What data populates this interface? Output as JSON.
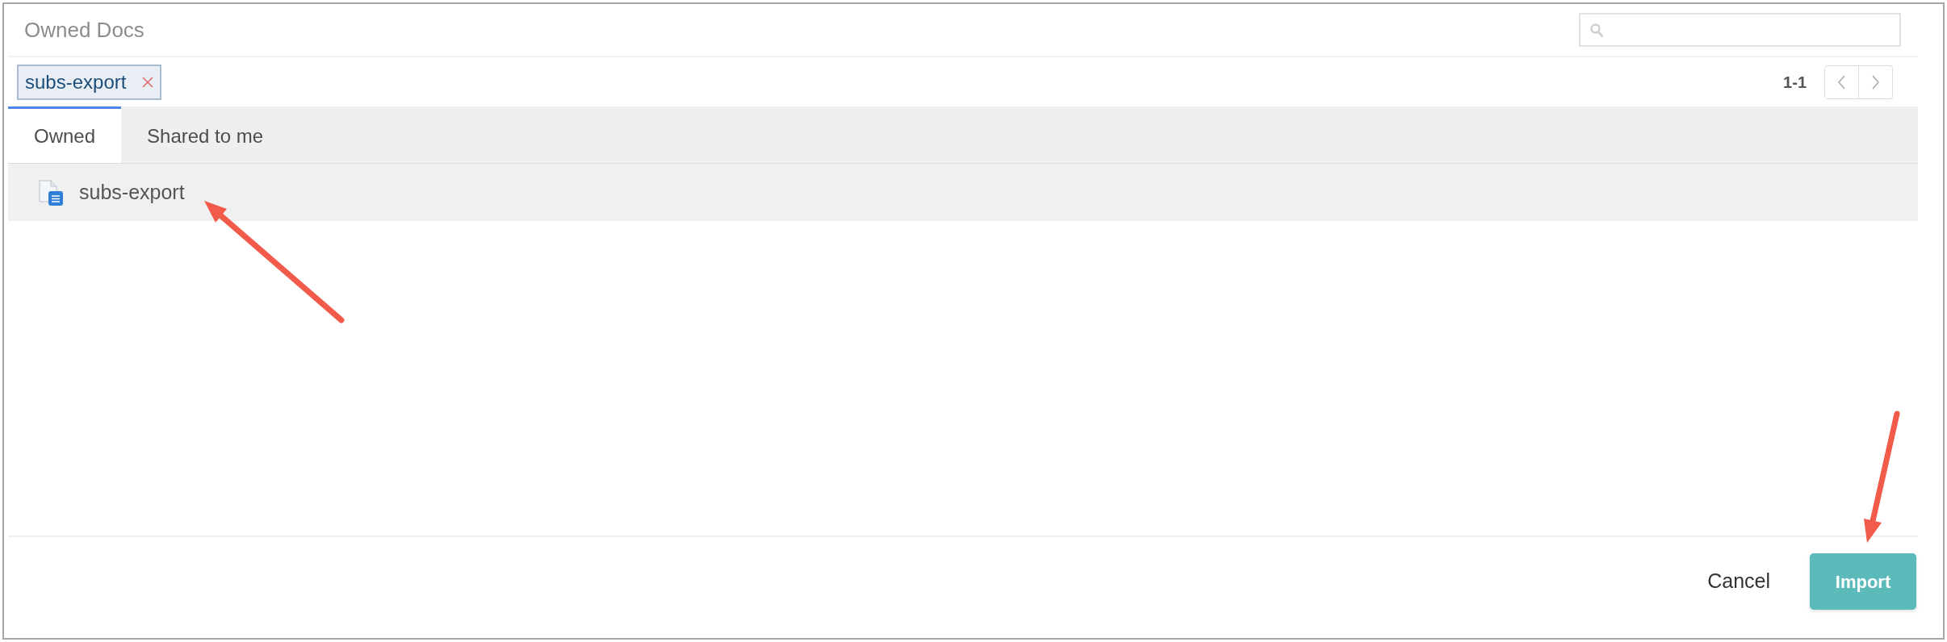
{
  "dialog": {
    "title": "Owned Docs"
  },
  "filter_chips": [
    {
      "label": "subs-export"
    }
  ],
  "pagination": {
    "range": "1-1"
  },
  "tabs": [
    {
      "label": "Owned",
      "selected": true
    },
    {
      "label": "Shared to me",
      "selected": false
    }
  ],
  "documents": [
    {
      "name": "subs-export",
      "selected": true
    }
  ],
  "buttons": [
    {
      "label": "Cancel",
      "kind": "link"
    },
    {
      "label": "Import",
      "kind": "primary"
    }
  ]
}
